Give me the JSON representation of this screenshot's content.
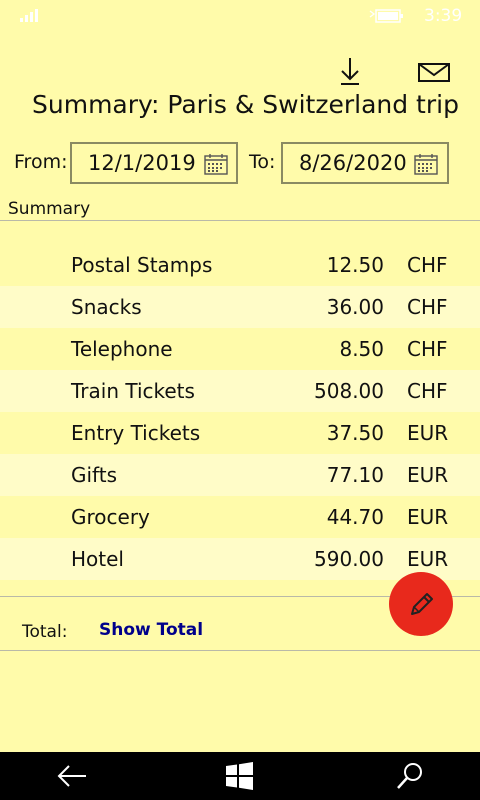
{
  "status": {
    "time": "3:39"
  },
  "header": {
    "title": "Summary: Paris & Switzerland trip"
  },
  "filters": {
    "from_label": "From:",
    "from_value": "12/1/2019",
    "to_label": "To:",
    "to_value": "8/26/2020"
  },
  "summary": {
    "section_label": "Summary",
    "items": [
      {
        "name": "Postal Stamps",
        "amount": "12.50",
        "currency": "CHF"
      },
      {
        "name": "Snacks",
        "amount": "36.00",
        "currency": "CHF"
      },
      {
        "name": "Telephone",
        "amount": "8.50",
        "currency": "CHF"
      },
      {
        "name": "Train Tickets",
        "amount": "508.00",
        "currency": "CHF"
      },
      {
        "name": "Entry Tickets",
        "amount": "37.50",
        "currency": "EUR"
      },
      {
        "name": "Gifts",
        "amount": "77.10",
        "currency": "EUR"
      },
      {
        "name": "Grocery",
        "amount": "44.70",
        "currency": "EUR"
      },
      {
        "name": "Hotel",
        "amount": "590.00",
        "currency": "EUR"
      }
    ]
  },
  "total": {
    "label": "Total:",
    "link_text": "Show Total"
  },
  "icons": {
    "download": "download-icon",
    "email": "email-icon",
    "calendar": "calendar-icon",
    "edit": "pencil-icon",
    "back": "back-arrow-icon",
    "start": "windows-icon",
    "search": "search-icon"
  },
  "colors": {
    "background": "#fffbaa",
    "alt_row": "#fffcc8",
    "fab": "#e8291c",
    "link": "#00008b"
  }
}
